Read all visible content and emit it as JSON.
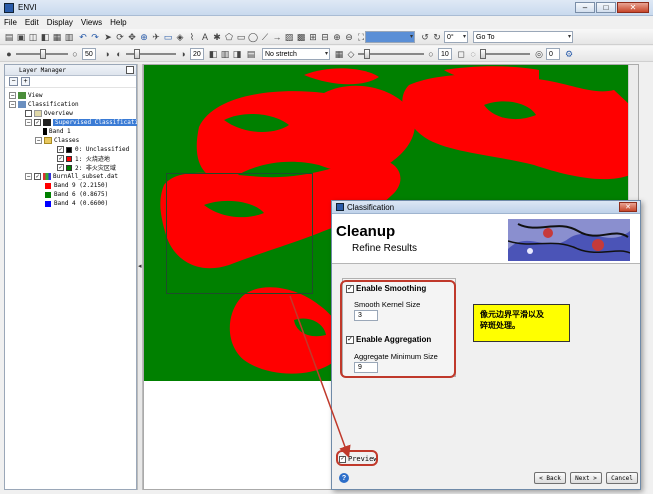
{
  "window": {
    "title": "ENVI",
    "controls": {
      "minimize": "–",
      "maximize": "□",
      "close": "✕"
    }
  },
  "menu": [
    "File",
    "Edit",
    "Display",
    "Views",
    "Help"
  ],
  "toolbar1": {
    "rotation": "0°",
    "goto": "Go To"
  },
  "toolbar2": {
    "brightness": "50",
    "contrast": "20",
    "stretch": "No stretch",
    "sharpen": "10",
    "transparency": "0"
  },
  "layer_manager": {
    "title": "Layer Manager",
    "tree": {
      "view": "View",
      "classification": "Classification",
      "overview": "Overview",
      "supervised": "Supervised Classificati",
      "band": "Band 1",
      "classes": "Classes",
      "class0": "0: Unclassified",
      "class1": "1: 火烧迹地",
      "class2": "2: 非火灾区域",
      "file": "BurnAll_subset.dat",
      "band9": "Band 9 (2.2150)",
      "band6": "Band 6 (0.8675)",
      "band4": "Band 4 (0.6600)"
    },
    "colors": {
      "class0": "#000000",
      "class1": "#ff0000",
      "class2": "#008000",
      "band9": "#ff0000",
      "band6": "#008000",
      "band4": "#0000ff"
    }
  },
  "map_colors": {
    "burn": "#ff0000",
    "non_burn": "#008000"
  },
  "dialog": {
    "title": "Classification",
    "heading": "Cleanup",
    "subheading": "Refine Results",
    "enable_smoothing": "Enable Smoothing",
    "smooth_kernel_label": "Smooth Kernel Size",
    "smooth_kernel_value": "3",
    "enable_aggregation": "Enable Aggregation",
    "aggregate_min_label": "Aggregate Minimum Size",
    "aggregate_min_value": "9",
    "preview": "Preview",
    "help": "?",
    "back": "< Back",
    "next": "Next >",
    "cancel": "Cancel"
  },
  "annotation": {
    "line1": "像元边界平滑以及",
    "line2": "碎斑处理。"
  }
}
